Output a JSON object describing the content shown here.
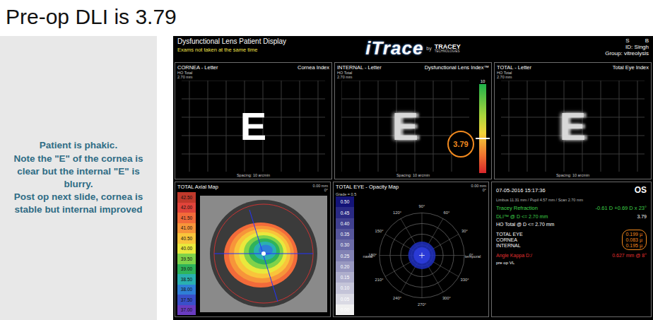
{
  "slide": {
    "title": "Pre-op DLI is 3.79",
    "notes": [
      "Patient is phakic.",
      "Note the \"E\" of the cornea is clear but the internal \"E\" is blurry.",
      "Post op next slide, cornea is stable but internal improved"
    ]
  },
  "display": {
    "title": "Dysfunctional Lens Patient Display",
    "warning": "Exams not taken at the same time",
    "logo": "iTrace",
    "logoBy": "by",
    "brand": "TRACEY",
    "brandSub": "TECHNOLOGIES",
    "patient": {
      "first": "S",
      "last": "B",
      "id": "ID:  Singh",
      "group": "Group:  vitreolysis"
    },
    "letterPanels": [
      {
        "title": "CORNEA - Letter",
        "index": "Cornea Index",
        "sub": [
          "HO Total",
          "2.70 mm"
        ],
        "letter": "E",
        "blurred": false,
        "spacing": "Spacing: 10 arcmin",
        "showDli": false
      },
      {
        "title": "INTERNAL - Letter",
        "index": "Dysfunctional Lens Index™",
        "sub": [
          "HO Total",
          "2.70 mm"
        ],
        "letter": "E",
        "blurred": true,
        "spacing": "Spacing: 10 arcmin",
        "showDli": true
      },
      {
        "title": "TOTAL - Letter",
        "index": "Total Eye Index",
        "sub": [
          "HO Total",
          "2.70 mm"
        ],
        "letter": "E",
        "blurred": true,
        "spacing": "Spacing: 10 arcmin",
        "showDli": false
      }
    ],
    "dli": {
      "value": "3.79",
      "level": 0.379,
      "max": "10"
    },
    "axialMap": {
      "title": "TOTAL Axial Map",
      "corner": [
        "0.00 mm",
        "0°"
      ],
      "scale": [
        {
          "value": "42.50",
          "color": "#c0392b"
        },
        {
          "value": "42.00",
          "color": "#e0443a"
        },
        {
          "value": "41.50",
          "color": "#f26b3a"
        },
        {
          "value": "41.00",
          "color": "#f7953a"
        },
        {
          "value": "40.50",
          "color": "#f9c43b"
        },
        {
          "value": "40.00",
          "color": "#e9e83c"
        },
        {
          "value": "39.50",
          "color": "#7fd24a"
        },
        {
          "value": "39.00",
          "color": "#2fb35a"
        },
        {
          "value": "38.50",
          "color": "#2ab0b0"
        },
        {
          "value": "38.00",
          "color": "#2f7fd6"
        },
        {
          "value": "37.50",
          "color": "#3a4fc9"
        },
        {
          "value": "37.00",
          "color": "#6a3cc0"
        }
      ]
    },
    "opacityMap": {
      "title": "TOTAL EYE - Opacity Map",
      "grade": "Grade = 0.5",
      "corner": [
        "0.00 mm",
        "0°"
      ],
      "nasal": "nasal",
      "temporal": "temporal",
      "scale": [
        "0.50",
        "0.45",
        "0.40",
        "0.35",
        "0.30",
        "0.25",
        "0.20",
        "0.15",
        "0.10",
        "0.05",
        "0.00"
      ],
      "angles": [
        "0°",
        "30°",
        "60°",
        "90°",
        "120°",
        "150°",
        "180°",
        "210°",
        "240°",
        "270°",
        "300°",
        "330°"
      ]
    },
    "info": {
      "date": "07-05-2016   15:17:36",
      "eye": "OS",
      "scan": "Limbus 11.31 mm / Pupil 4.57 mm / Scan 2.70 mm",
      "refractionLabel": "Tracey Refraction",
      "refraction": "-0.61 D +0.69 D x 23°",
      "dliLabel": "DLI™ @ D <= 2.70 mm",
      "dliValue": "3.79",
      "hoLabel": "HO Total @ D <= 2.70 mm",
      "hoRows": [
        {
          "label": "TOTAL EYE",
          "value": "0.199 µ"
        },
        {
          "label": "CORNEA",
          "value": "0.083 µ"
        },
        {
          "label": "INTERNAL",
          "value": "0.195 µ"
        }
      ],
      "kappaLabel": "Angle Kappa D:/",
      "kappa": "0.627 mm @ 8°",
      "note": "pre op VL"
    }
  }
}
